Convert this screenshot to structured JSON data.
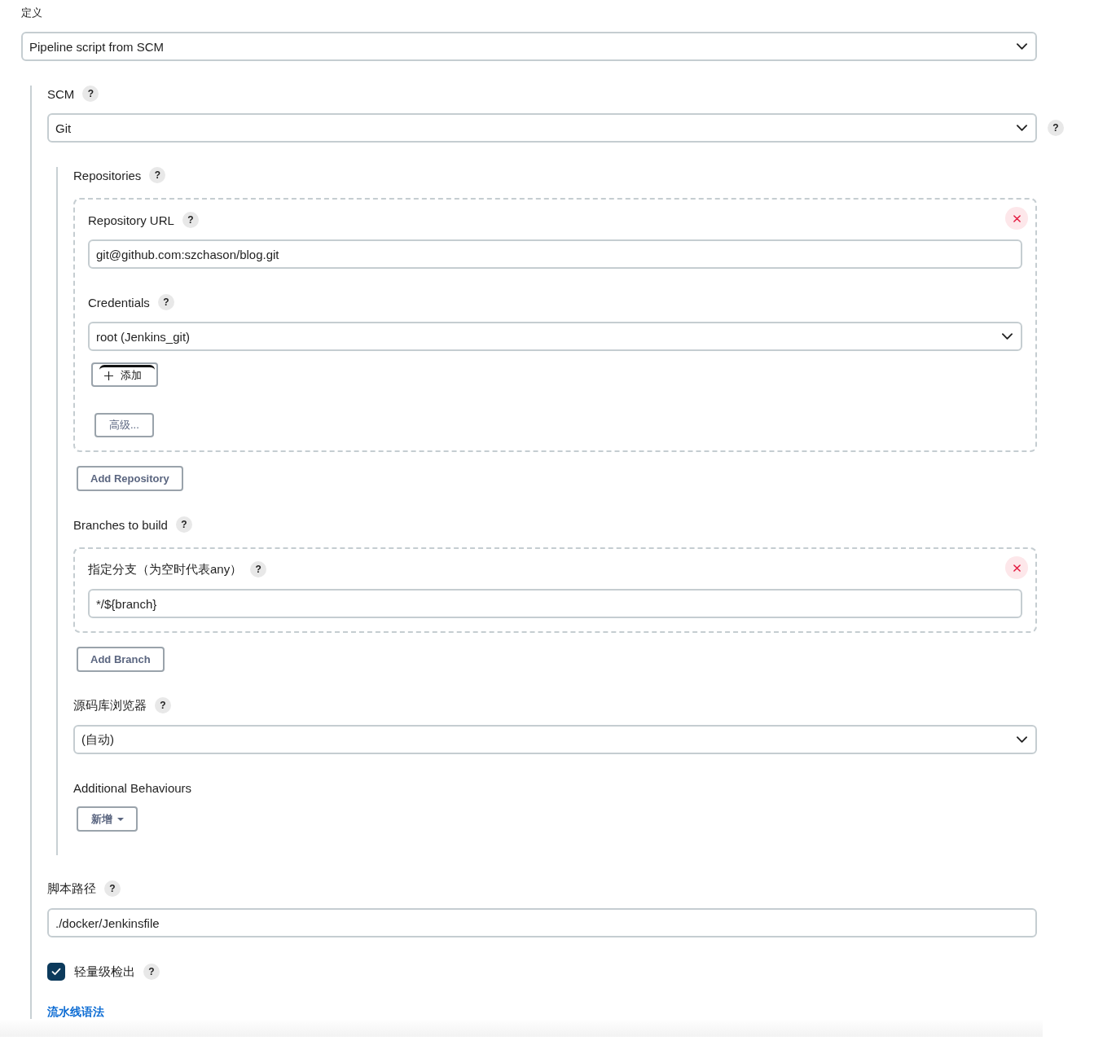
{
  "definition": {
    "label": "定义",
    "value": "Pipeline script from SCM"
  },
  "scm": {
    "label": "SCM",
    "help": "?",
    "value": "Git",
    "select_help": "?",
    "repositories": {
      "label": "Repositories",
      "help": "?",
      "items": [
        {
          "url_label": "Repository URL",
          "url_help": "?",
          "url": "git@github.com:szchason/blog.git",
          "credentials_label": "Credentials",
          "credentials_help": "?",
          "credentials": "root (Jenkins_git)",
          "add_button": "添加",
          "advanced_button": "高级..."
        }
      ],
      "add_button": "Add Repository"
    },
    "branches": {
      "label": "Branches to build",
      "help": "?",
      "items": [
        {
          "label": "指定分支（为空时代表any）",
          "help": "?",
          "value": "*/${branch}"
        }
      ],
      "add_button": "Add Branch"
    },
    "browser": {
      "label": "源码库浏览器",
      "help": "?",
      "value": "(自动)"
    },
    "additional_behaviours": {
      "label": "Additional Behaviours",
      "add_button": "新增"
    }
  },
  "script_path": {
    "label": "脚本路径",
    "help": "?",
    "value": "./docker/Jenkinsfile"
  },
  "lightweight_checkout": {
    "label": "轻量级检出",
    "help": "?",
    "checked": true
  },
  "syntax_link": "流水线语法"
}
